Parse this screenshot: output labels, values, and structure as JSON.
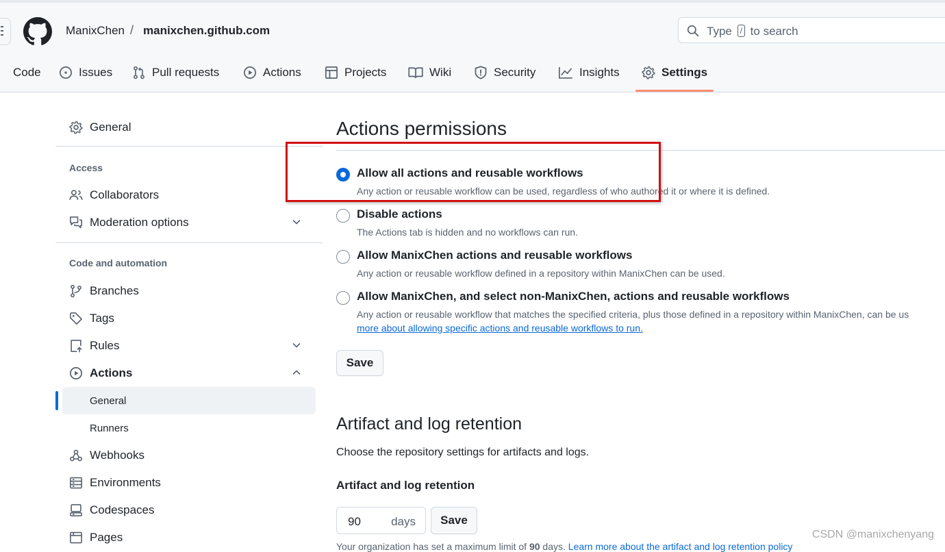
{
  "header": {
    "owner": "ManixChen",
    "separator": "/",
    "repo": "manixchen.github.com",
    "search": {
      "before": "Type",
      "key": "/",
      "after": "to search"
    }
  },
  "tabs": [
    {
      "label": "Code",
      "icon": "code-icon"
    },
    {
      "label": "Issues",
      "icon": "issue-opened-icon"
    },
    {
      "label": "Pull requests",
      "icon": "git-pull-request-icon"
    },
    {
      "label": "Actions",
      "icon": "play-icon"
    },
    {
      "label": "Projects",
      "icon": "table-icon"
    },
    {
      "label": "Wiki",
      "icon": "book-icon"
    },
    {
      "label": "Security",
      "icon": "shield-icon"
    },
    {
      "label": "Insights",
      "icon": "graph-icon"
    },
    {
      "label": "Settings",
      "icon": "gear-icon",
      "active": true
    }
  ],
  "sidebar": {
    "general": "General",
    "access_heading": "Access",
    "access": [
      "Collaborators",
      "Moderation options"
    ],
    "code_heading": "Code and automation",
    "branches": "Branches",
    "tags": "Tags",
    "rules": "Rules",
    "actions": "Actions",
    "actions_sub": [
      "General",
      "Runners"
    ],
    "rest": [
      "Webhooks",
      "Environments",
      "Codespaces",
      "Pages"
    ]
  },
  "main": {
    "permissions_title": "Actions permissions",
    "options": [
      {
        "label": "Allow all actions and reusable workflows",
        "desc": "Any action or reusable workflow can be used, regardless of who authored it or where it is defined.",
        "checked": true
      },
      {
        "label": "Disable actions",
        "desc": "The Actions tab is hidden and no workflows can run.",
        "checked": false
      },
      {
        "label": "Allow ManixChen actions and reusable workflows",
        "desc": "Any action or reusable workflow defined in a repository within ManixChen can be used.",
        "checked": false
      },
      {
        "label": "Allow ManixChen, and select non-ManixChen, actions and reusable workflows",
        "desc": "Any action or reusable workflow that matches the specified criteria, plus those defined in a repository within ManixChen, can be us",
        "link": "more about allowing specific actions and reusable workflows to run",
        "link_end": ".",
        "checked": false
      }
    ],
    "save_label": "Save",
    "retention_title": "Artifact and log retention",
    "retention_desc": "Choose the repository settings for artifacts and logs.",
    "retention_sub": "Artifact and log retention",
    "retention_value": "90",
    "retention_unit": "days",
    "retention_save": "Save",
    "footnote_text": "Your organization has set a maximum limit of",
    "footnote_bold": "90",
    "footnote_after": "days.",
    "footnote_link": "Learn more about the artifact and log retention policy"
  },
  "watermark": "CSDN @manixchenyang",
  "colors": {
    "accent": "#0969da",
    "tab_underline": "#fd8c73",
    "highlight_box": "#d10f0f"
  }
}
